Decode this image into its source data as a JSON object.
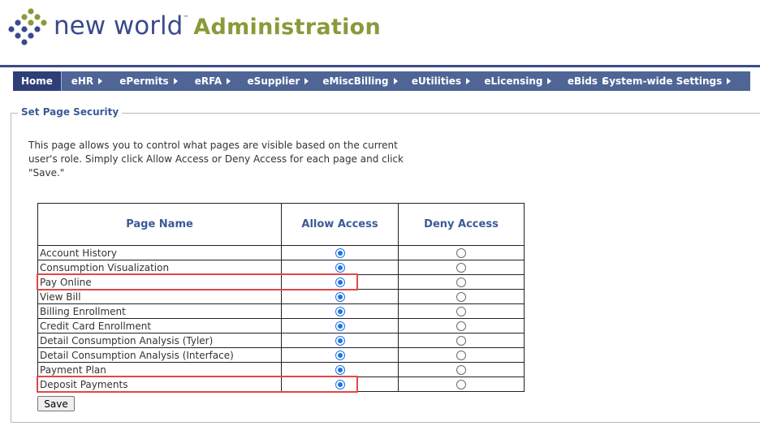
{
  "header": {
    "logo_text": "new world",
    "logo_tm": "™",
    "title": "Administration"
  },
  "nav": {
    "items": [
      {
        "label": "Home",
        "has_arrow": false
      },
      {
        "label": "eHR",
        "has_arrow": true
      },
      {
        "label": "ePermits",
        "has_arrow": true
      },
      {
        "label": "eRFA",
        "has_arrow": true
      },
      {
        "label": "eSupplier",
        "has_arrow": true
      },
      {
        "label": "eMiscBilling",
        "has_arrow": true
      },
      {
        "label": "eUtilities",
        "has_arrow": true
      },
      {
        "label": "eLicensing",
        "has_arrow": true
      },
      {
        "label": "eBids",
        "has_arrow": true
      },
      {
        "label": "System-wide Settings",
        "has_arrow": true
      }
    ]
  },
  "section": {
    "legend": "Set Page Security",
    "description": "This page allows you to control what pages are visible based on the current user's role. Simply click Allow Access or Deny Access for each page and click \"Save.\""
  },
  "table": {
    "headers": [
      "Page Name",
      "Allow Access",
      "Deny Access"
    ],
    "rows": [
      {
        "name": "Account History",
        "allow": true
      },
      {
        "name": "Consumption Visualization",
        "allow": true
      },
      {
        "name": "Pay Online",
        "allow": true
      },
      {
        "name": "View Bill",
        "allow": true
      },
      {
        "name": "Billing Enrollment",
        "allow": true
      },
      {
        "name": "Credit Card Enrollment",
        "allow": true
      },
      {
        "name": "Detail Consumption Analysis (Tyler)",
        "allow": true
      },
      {
        "name": "Detail Consumption Analysis (Interface)",
        "allow": true
      },
      {
        "name": "Payment Plan",
        "allow": true
      },
      {
        "name": "Deposit Payments",
        "allow": true
      }
    ]
  },
  "save_label": "Save",
  "colors": {
    "brand_blue": "#3b4a8c",
    "brand_green": "#8a9a3a",
    "nav_bg": "#4f6596",
    "highlight_red": "#e04848"
  }
}
